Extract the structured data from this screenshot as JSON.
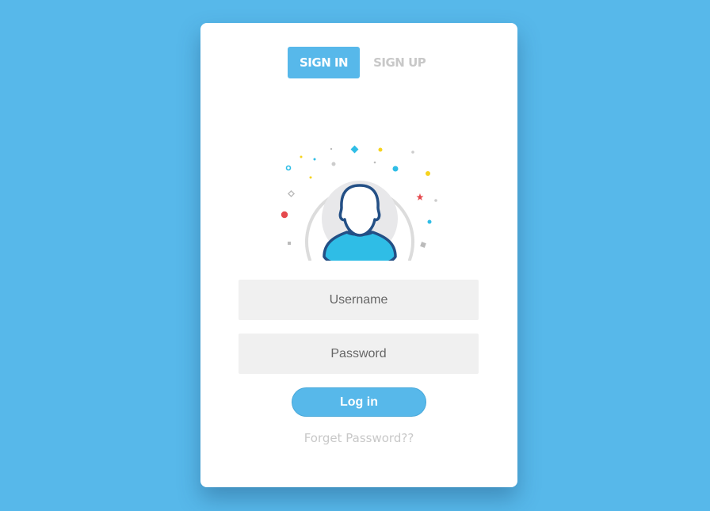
{
  "colors": {
    "background": "#57b8ea",
    "accent": "#57b8ea",
    "avatar_outline": "#234f85",
    "avatar_body": "#2fbde6"
  },
  "tabs": {
    "sign_in": "SIGN IN",
    "sign_up": "SIGN UP",
    "active": "sign_in"
  },
  "avatar": {
    "icon": "user-avatar-icon"
  },
  "form": {
    "username_placeholder": "Username",
    "password_placeholder": "Password",
    "login_label": "Log in",
    "forgot_label": "Forget Password??"
  }
}
